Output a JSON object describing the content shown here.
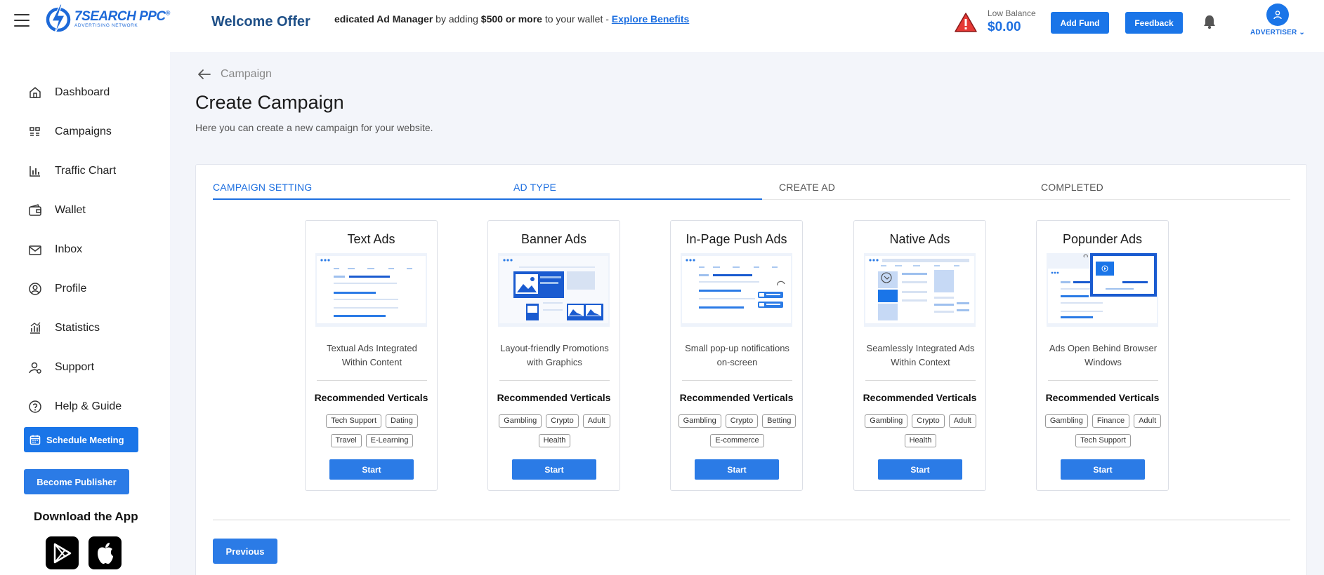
{
  "header": {
    "logo_main": "7SEARCH PPC",
    "logo_reg": "®",
    "logo_sub": "ADVERTISING NETWORK",
    "welcome": "Welcome Offer",
    "ticker": {
      "pre": "edicated Ad Manager",
      "mid1": " by adding ",
      "amount": "$500 or more",
      "mid2": " to your wallet - ",
      "link": "Explore Benefits"
    },
    "balance_label": "Low Balance",
    "balance_value": "$0.00",
    "add_fund": "Add Fund",
    "feedback": "Feedback",
    "account_label": "ADVERTISER",
    "icons": [
      "menu-icon",
      "warning-icon",
      "bell-icon",
      "user-icon",
      "chevron-down-icon"
    ]
  },
  "sidebar": {
    "items": [
      {
        "label": "Dashboard",
        "icon": "home-icon"
      },
      {
        "label": "Campaigns",
        "icon": "campaigns-icon"
      },
      {
        "label": "Traffic Chart",
        "icon": "bar-chart-icon"
      },
      {
        "label": "Wallet",
        "icon": "wallet-icon"
      },
      {
        "label": "Inbox",
        "icon": "inbox-icon"
      },
      {
        "label": "Profile",
        "icon": "profile-icon"
      },
      {
        "label": "Statistics",
        "icon": "statistics-icon"
      },
      {
        "label": "Support",
        "icon": "support-icon"
      },
      {
        "label": "Help & Guide",
        "icon": "help-icon"
      }
    ],
    "schedule_meeting": "Schedule Meeting",
    "become_publisher": "Become Publisher",
    "download_app": "Download the App"
  },
  "main": {
    "breadcrumb": "Campaign",
    "title": "Create Campaign",
    "subtitle": "Here you can create a new campaign for your website.",
    "steps": [
      {
        "label": "CAMPAIGN SETTING",
        "active": true
      },
      {
        "label": "AD TYPE",
        "active": true
      },
      {
        "label": "CREATE AD",
        "active": false
      },
      {
        "label": "COMPLETED",
        "active": false
      }
    ],
    "recommended_label": "Recommended Verticals",
    "start_label": "Start",
    "ad_types": [
      {
        "title": "Text Ads",
        "desc": "Textual Ads Integrated Within Content",
        "tags": [
          "Tech Support",
          "Dating",
          "Travel",
          "E-Learning"
        ]
      },
      {
        "title": "Banner Ads",
        "desc": "Layout-friendly Promotions with Graphics",
        "tags": [
          "Gambling",
          "Crypto",
          "Adult",
          "Health"
        ]
      },
      {
        "title": "In-Page Push Ads",
        "desc": "Small pop-up notifications on-screen",
        "tags": [
          "Gambling",
          "Crypto",
          "Betting",
          "E-commerce"
        ]
      },
      {
        "title": "Native Ads",
        "desc": "Seamlessly Integrated Ads Within Context",
        "tags": [
          "Gambling",
          "Crypto",
          "Adult",
          "Health"
        ]
      },
      {
        "title": "Popunder Ads",
        "desc": "Ads Open Behind Browser Windows",
        "tags": [
          "Gambling",
          "Finance",
          "Adult",
          "Tech Support"
        ]
      }
    ],
    "previous": "Previous"
  },
  "colors": {
    "primary": "#1a75e8",
    "heading": "#1e4f87",
    "warning": "#e53935"
  }
}
